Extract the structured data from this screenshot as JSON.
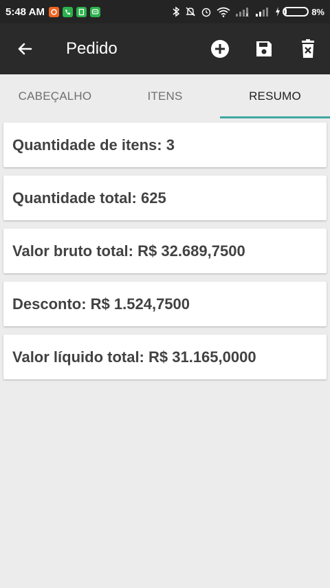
{
  "status_bar": {
    "time": "5:48 AM",
    "battery_percent": "8%",
    "battery_level": 0.08,
    "notification_icons": [
      {
        "name": "app-notification-icon",
        "color": "#f26522"
      },
      {
        "name": "phone-notification-icon",
        "color": "#2bb24c"
      },
      {
        "name": "clipboard-notification-icon",
        "color": "#2bb24c"
      },
      {
        "name": "chat-notification-icon",
        "color": "#2bb24c"
      }
    ]
  },
  "app_bar": {
    "title": "Pedido",
    "background": "#2a2a2a",
    "actions": [
      "add-icon",
      "save-icon",
      "delete-icon"
    ]
  },
  "tabs": [
    {
      "label": "CABEÇALHO",
      "active": false
    },
    {
      "label": "ITENS",
      "active": false
    },
    {
      "label": "RESUMO",
      "active": true
    }
  ],
  "accent_color": "#3fa7a0",
  "summary": [
    {
      "text": "Quantidade de itens: 3"
    },
    {
      "text": "Quantidade total: 625"
    },
    {
      "text": "Valor bruto total: R$ 32.689,7500"
    },
    {
      "text": "Desconto: R$ 1.524,7500"
    },
    {
      "text": "Valor líquido total: R$ 31.165,0000"
    }
  ]
}
